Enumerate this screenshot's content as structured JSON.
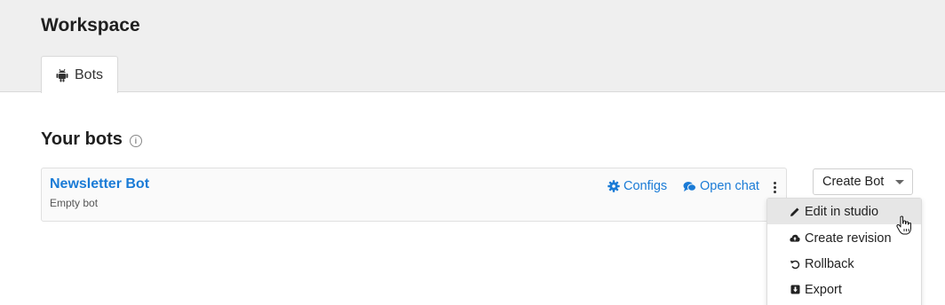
{
  "header": {
    "workspace_title": "Workspace",
    "tabs": [
      {
        "label": "Bots",
        "icon": "android-icon",
        "active": true
      }
    ]
  },
  "main": {
    "section_title": "Your bots",
    "section_info_icon": "info-icon",
    "bots": [
      {
        "name": "Newsletter Bot",
        "description": "Empty bot",
        "configs_label": "Configs",
        "open_chat_label": "Open chat"
      }
    ],
    "create_bot_label": "Create Bot"
  },
  "dropdown_menu": {
    "items": [
      {
        "label": "Edit in studio",
        "icon": "pencil-icon",
        "hovered": true
      },
      {
        "label": "Create revision",
        "icon": "cloud-upload-icon",
        "hovered": false
      },
      {
        "label": "Rollback",
        "icon": "undo-icon",
        "hovered": false
      },
      {
        "label": "Export",
        "icon": "export-icon",
        "hovered": false
      }
    ]
  },
  "colors": {
    "link_blue": "#1a7bd6",
    "header_bg": "#efefef",
    "menu_hover_bg": "#e6e6e6"
  }
}
